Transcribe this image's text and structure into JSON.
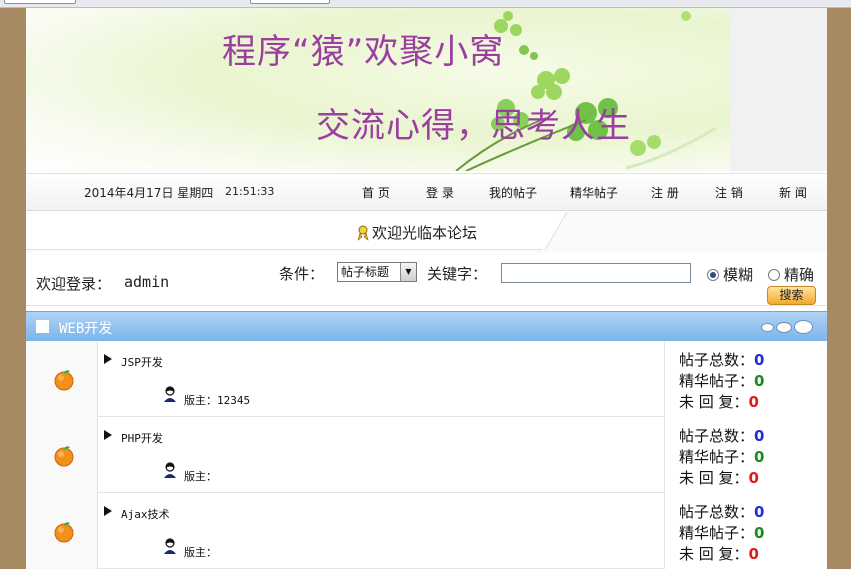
{
  "banner": {
    "line1": "程序“猿”欢聚小窝",
    "line2": "交流心得，思考人生"
  },
  "nav": {
    "date": "2014年4月17日 星期四",
    "time": "21:51:33",
    "links": [
      "首 页",
      "登 录",
      "我的帖子",
      "精华帖子",
      "注 册",
      "注 销",
      "新 闻"
    ]
  },
  "welcome": {
    "text": "欢迎光临本论坛"
  },
  "search": {
    "login_label": "欢迎登录：",
    "login_user": "admin",
    "condition_label": "条件：",
    "condition_value": "帖子标题",
    "keyword_label": "关键字：",
    "keyword_value": "",
    "radio_fuzzy": "模糊",
    "radio_exact": "精确",
    "fuzzy_selected": true,
    "button": "搜索"
  },
  "category": {
    "title": "WEB开发"
  },
  "stat_labels": {
    "total": "帖子总数：",
    "elite": "精华帖子：",
    "reply": "未 回 复："
  },
  "forums": [
    {
      "name": "JSP开发",
      "moderator": "版主：12345",
      "total": "0",
      "elite": "0",
      "reply": "0"
    },
    {
      "name": "PHP开发",
      "moderator": "版主：",
      "total": "0",
      "elite": "0",
      "reply": "0"
    },
    {
      "name": "Ajax技术",
      "moderator": "版主：",
      "total": "0",
      "elite": "0",
      "reply": "0"
    }
  ],
  "colors": {
    "banner_text": "#9a3fa0",
    "category_bar": "#7cb4ea",
    "total_value": "#1f2fd6",
    "elite_value": "#1c8a1c",
    "reply_value": "#e01c1c",
    "page_side": "#a88a62"
  }
}
